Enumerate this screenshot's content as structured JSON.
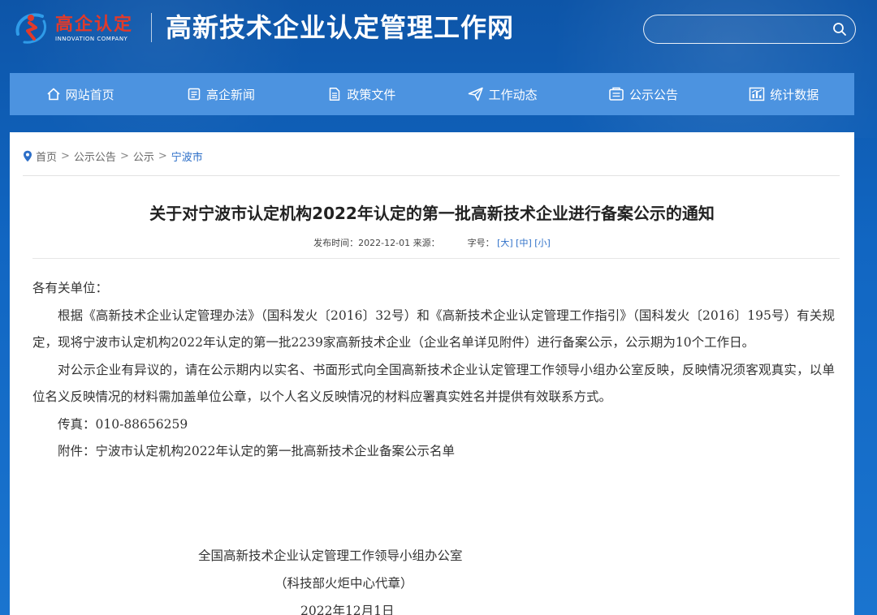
{
  "header": {
    "logo_cn": "高企认定",
    "logo_en": "INNOVATION COMPANY",
    "site_title": "高新技术企业认定管理工作网",
    "search_placeholder": ""
  },
  "nav": [
    {
      "label": "网站首页",
      "icon": "home-icon"
    },
    {
      "label": "高企新闻",
      "icon": "news-icon"
    },
    {
      "label": "政策文件",
      "icon": "document-icon"
    },
    {
      "label": "工作动态",
      "icon": "send-icon"
    },
    {
      "label": "公示公告",
      "icon": "announcement-icon"
    },
    {
      "label": "统计数据",
      "icon": "statistics-icon"
    }
  ],
  "breadcrumb": {
    "items": [
      "首页",
      "公示公告",
      "公示"
    ],
    "current": "宁波市",
    "separator": ">"
  },
  "article": {
    "title": "关于对宁波市认定机构2022年认定的第一批高新技术企业进行备案公示的通知",
    "publish_label": "发布时间：2022-12-01 来源：",
    "font_size_label": "字号：",
    "font_size_options": [
      "[大]",
      "[中]",
      "[小]"
    ],
    "greeting": "各有关单位：",
    "paragraphs": [
      "根据《高新技术企业认定管理办法》（国科发火〔2016〕32号）和《高新技术企业认定管理工作指引》（国科发火〔2016〕195号）有关规定，现将宁波市认定机构2022年认定的第一批2239家高新技术企业（企业名单详见附件）进行备案公示，公示期为10个工作日。",
      "对公示企业有异议的，请在公示期内以实名、书面形式向全国高新技术企业认定管理工作领导小组办公室反映，反映情况须客观真实，以单位名义反映情况的材料需加盖单位公章，以个人名义反映情况的材料应署真实姓名并提供有效联系方式。",
      "传真：010-88656259",
      "附件：宁波市认定机构2022年认定的第一批高新技术企业备案公示名单"
    ],
    "signature_org": "全国高新技术企业认定管理工作领导小组办公室",
    "signature_note": "（科技部火炬中心代章）",
    "signature_date": "2022年12月1日"
  },
  "colors": {
    "header_bg": "#1166c2",
    "nav_bg": "#4c93e0",
    "logo_red": "#e23a2a",
    "link_blue": "#2d6fc8"
  }
}
